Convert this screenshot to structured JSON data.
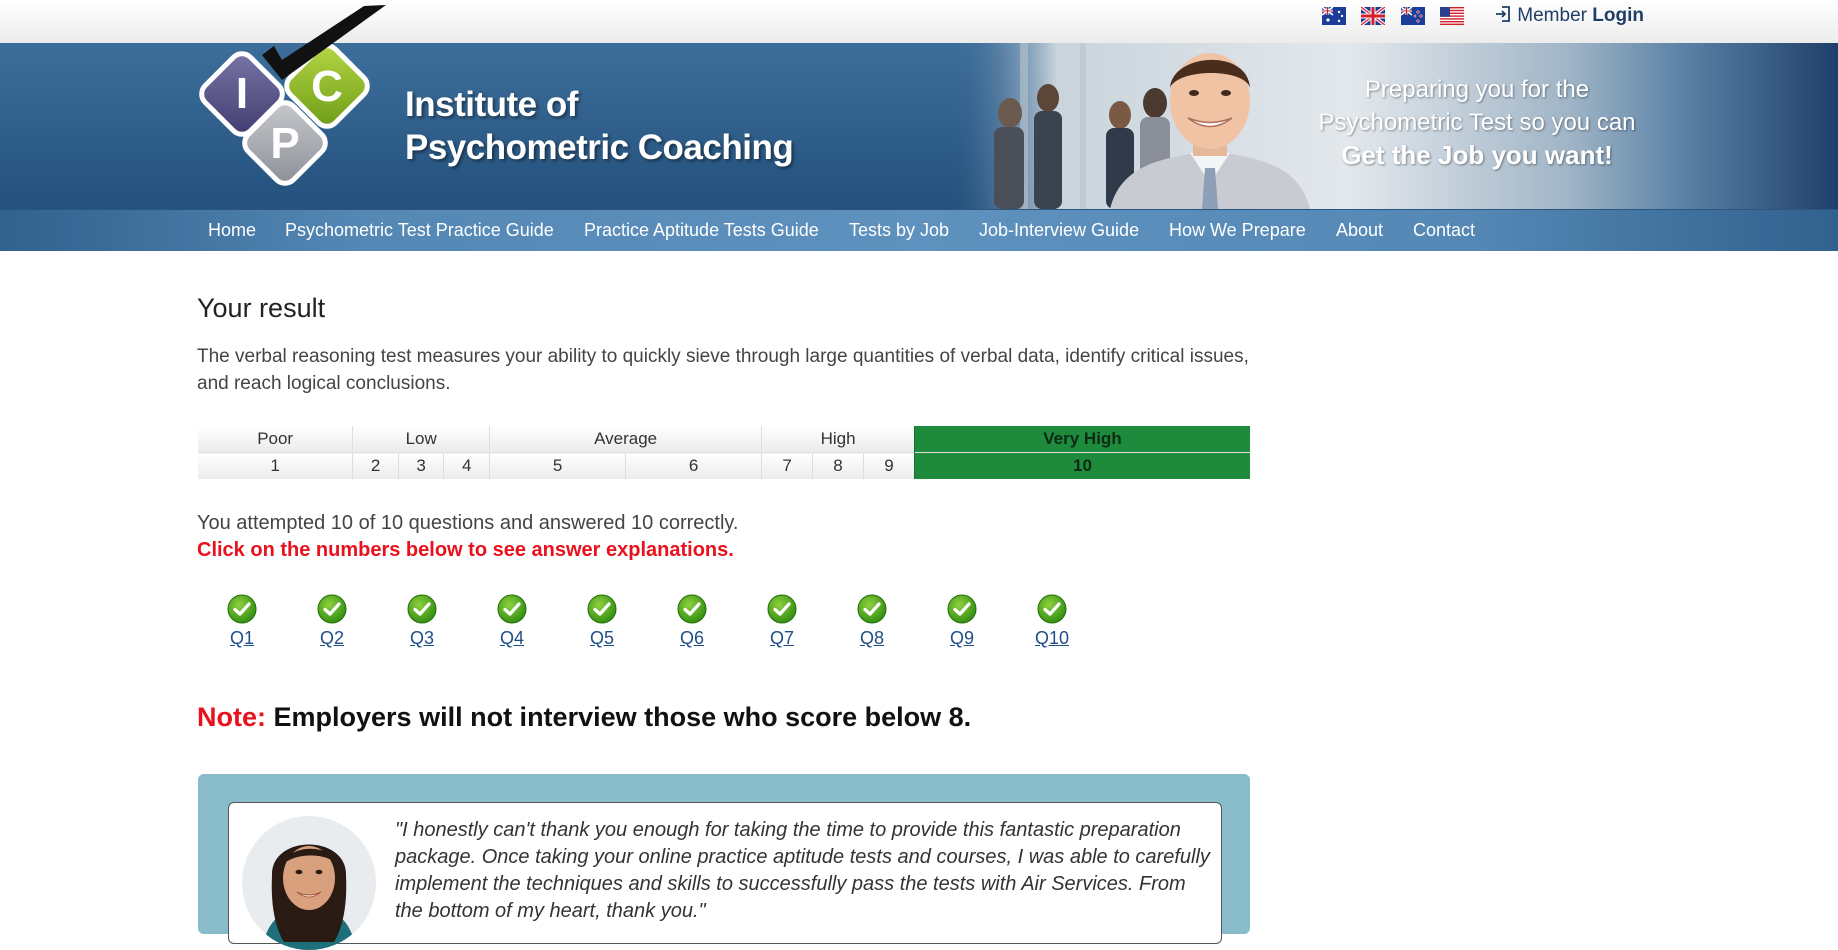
{
  "topbar": {
    "flags": [
      "flag-australia-icon",
      "flag-uk-icon",
      "flag-new-zealand-icon",
      "flag-usa-icon"
    ],
    "member_prefix": "Member",
    "member_login": "Login"
  },
  "banner": {
    "logo_letters": [
      "I",
      "C",
      "P"
    ],
    "brand_line1": "Institute of",
    "brand_line2": "Psychometric Coaching",
    "tagline_line1": "Preparing you for the",
    "tagline_line2": "Psychometric Test so you can",
    "tagline_line3": "Get the Job you want!"
  },
  "nav": {
    "items": [
      "Home",
      "Psychometric Test Practice Guide",
      "Practice Aptitude Tests Guide",
      "Tests by Job",
      "Job-Interview Guide",
      "How We Prepare",
      "About",
      "Contact"
    ]
  },
  "main": {
    "title": "Your result",
    "description": "The verbal reasoning test measures your ability to quickly sieve through large quantities of verbal data, identify critical issues, and reach logical conclusions.",
    "scale_bands": [
      {
        "label": "Poor"
      },
      {
        "label": "Low"
      },
      {
        "label": "Average"
      },
      {
        "label": "High"
      },
      {
        "label": "Very High"
      }
    ],
    "scale_numbers": [
      "1",
      "2",
      "3",
      "4",
      "5",
      "6",
      "7",
      "8",
      "9",
      "10"
    ],
    "score": 10,
    "attempt_text": "You attempted 10 of 10 questions and answered 10 correctly.",
    "click_text": "Click on the numbers below to see answer explanations.",
    "questions": [
      "Q1",
      "Q2",
      "Q3",
      "Q4",
      "Q5",
      "Q6",
      "Q7",
      "Q8",
      "Q9",
      "Q10"
    ],
    "note_label": "Note:",
    "note_text": "Employers will not interview those who score below 8."
  },
  "testimonial": {
    "quote": "\"I honestly can't thank you enough for taking the time to provide this fantastic preparation package. Once taking your online practice aptitude tests and courses, I was able to carefully implement the techniques and skills to successfully pass the tests with Air Services. From the bottom of my heart, thank you.\""
  },
  "colors": {
    "accent_blue": "#2f5e8a",
    "very_high_green": "#1d8a3c",
    "alert_red": "#e8111c",
    "testimonial_bg": "#88bccb"
  }
}
